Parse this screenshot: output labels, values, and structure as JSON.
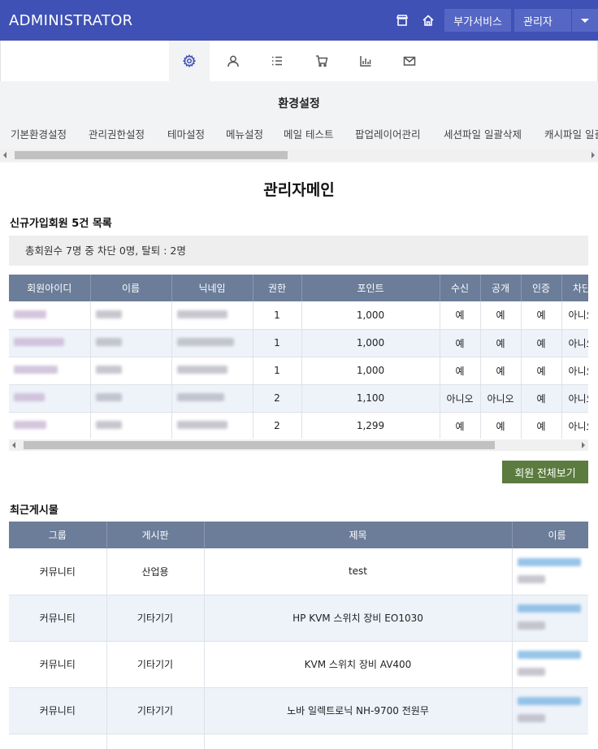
{
  "header": {
    "brand": "ADMINISTRATOR",
    "addon_label": "부가서비스",
    "admin_label": "관리자"
  },
  "icon_nav": [
    {
      "icon": "gear-icon",
      "active": true
    },
    {
      "icon": "user-icon",
      "active": false
    },
    {
      "icon": "list-icon",
      "active": false
    },
    {
      "icon": "cart-icon",
      "active": false
    },
    {
      "icon": "chart-icon",
      "active": false
    },
    {
      "icon": "mail-icon",
      "active": false
    }
  ],
  "submenu": {
    "title": "환경설정",
    "tabs": [
      "기본환경설정",
      "관리권한설정",
      "테마설정",
      "메뉴설정",
      "메일 테스트",
      "팝업레이어관리",
      "세션파일 일괄삭제",
      "캐시파일 일괄삭제"
    ]
  },
  "main": {
    "title": "관리자메인",
    "new_members": {
      "heading": "신규가입회원 5건 목록",
      "summary": "총회원수 7명 중 차단 0명, 탈퇴 : 2명",
      "columns": [
        "회원아이디",
        "이름",
        "닉네임",
        "권한",
        "포인트",
        "수신",
        "공개",
        "인증",
        "차단"
      ],
      "rows": [
        {
          "level": "1",
          "point": "1,000",
          "receive": "예",
          "open": "예",
          "cert": "예",
          "block": "아니오"
        },
        {
          "level": "1",
          "point": "1,000",
          "receive": "예",
          "open": "예",
          "cert": "예",
          "block": "아니오"
        },
        {
          "level": "1",
          "point": "1,000",
          "receive": "예",
          "open": "예",
          "cert": "예",
          "block": "아니오"
        },
        {
          "level": "2",
          "point": "1,100",
          "receive": "아니오",
          "open": "아니오",
          "cert": "예",
          "block": "아니오"
        },
        {
          "level": "2",
          "point": "1,299",
          "receive": "예",
          "open": "예",
          "cert": "예",
          "block": "아니오"
        }
      ],
      "view_all_label": "회원 전체보기"
    },
    "recent_posts": {
      "heading": "최근게시물",
      "columns": [
        "그룹",
        "게시판",
        "제목",
        "이름"
      ],
      "rows": [
        {
          "group": "커뮤니티",
          "board": "산업용",
          "subject": "test"
        },
        {
          "group": "커뮤니티",
          "board": "기타기기",
          "subject": "HP KVM 스위치 장비 EO1030"
        },
        {
          "group": "커뮤니티",
          "board": "기타기기",
          "subject": "KVM 스위치 장비 AV400"
        },
        {
          "group": "커뮤니티",
          "board": "기타기기",
          "subject": "노바 일렉트로닉 NH-9700 전원무"
        }
      ]
    }
  }
}
